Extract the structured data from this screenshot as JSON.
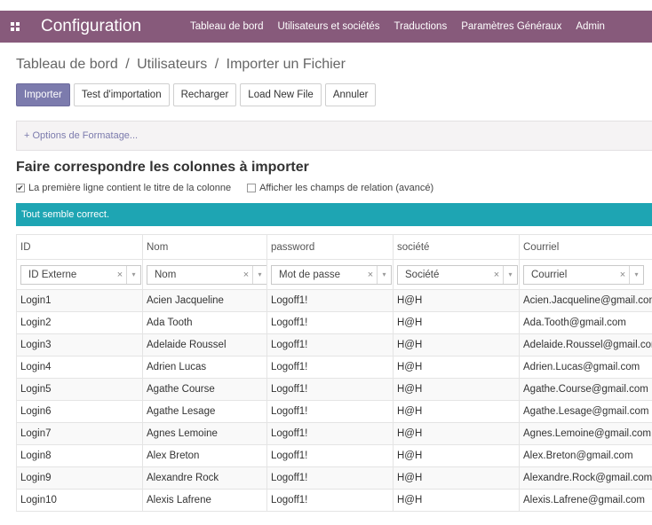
{
  "navbar": {
    "title": "Configuration",
    "menu": [
      "Tableau de bord",
      "Utilisateurs et sociétés",
      "Traductions",
      "Paramètres Généraux",
      "Admin"
    ]
  },
  "breadcrumb": {
    "items": [
      "Tableau de bord",
      "Utilisateurs",
      "Importer un Fichier"
    ],
    "separator": "/"
  },
  "buttons": {
    "import": "Importer",
    "test": "Test d'importation",
    "reload": "Recharger",
    "load_new": "Load New File",
    "cancel": "Annuler"
  },
  "options": {
    "label": "+ Options de Formatage..."
  },
  "section": {
    "title": "Faire correspondre les colonnes à importer"
  },
  "checks": {
    "first_row": {
      "label": "La première ligne contient le titre de la colonne",
      "checked": true
    },
    "relations": {
      "label": "Afficher les champs de relation (avancé)",
      "checked": false
    }
  },
  "alert": {
    "text": "Tout semble correct."
  },
  "table": {
    "headers": [
      "ID",
      "Nom",
      "password",
      "société",
      "Courriel"
    ],
    "selectors": [
      "ID Externe",
      "Nom",
      "Mot de passe",
      "Société",
      "Courriel"
    ],
    "rows": [
      [
        "Login1",
        "Acien Jacqueline",
        "Logoff1!",
        "H@H",
        "Acien.Jacqueline@gmail.com"
      ],
      [
        "Login2",
        "Ada Tooth",
        "Logoff1!",
        "H@H",
        "Ada.Tooth@gmail.com"
      ],
      [
        "Login3",
        "Adelaide Roussel",
        "Logoff1!",
        "H@H",
        "Adelaide.Roussel@gmail.com"
      ],
      [
        "Login4",
        "Adrien Lucas",
        "Logoff1!",
        "H@H",
        "Adrien.Lucas@gmail.com"
      ],
      [
        "Login5",
        "Agathe Course",
        "Logoff1!",
        "H@H",
        "Agathe.Course@gmail.com"
      ],
      [
        "Login6",
        "Agathe Lesage",
        "Logoff1!",
        "H@H",
        "Agathe.Lesage@gmail.com"
      ],
      [
        "Login7",
        "Agnes Lemoine",
        "Logoff1!",
        "H@H",
        "Agnes.Lemoine@gmail.com"
      ],
      [
        "Login8",
        "Alex Breton",
        "Logoff1!",
        "H@H",
        "Alex.Breton@gmail.com"
      ],
      [
        "Login9",
        "Alexandre Rock",
        "Logoff1!",
        "H@H",
        "Alexandre.Rock@gmail.com"
      ],
      [
        "Login10",
        "Alexis Lafrene",
        "Logoff1!",
        "H@H",
        "Alexis.Lafrene@gmail.com"
      ]
    ]
  },
  "colors": {
    "navbar": "#875a7b",
    "primary_button": "#7c7bad",
    "alert": "#1ea5b3"
  },
  "icons": {
    "apps": "apps-grid-icon",
    "clear": "×",
    "dropdown": "▾"
  }
}
